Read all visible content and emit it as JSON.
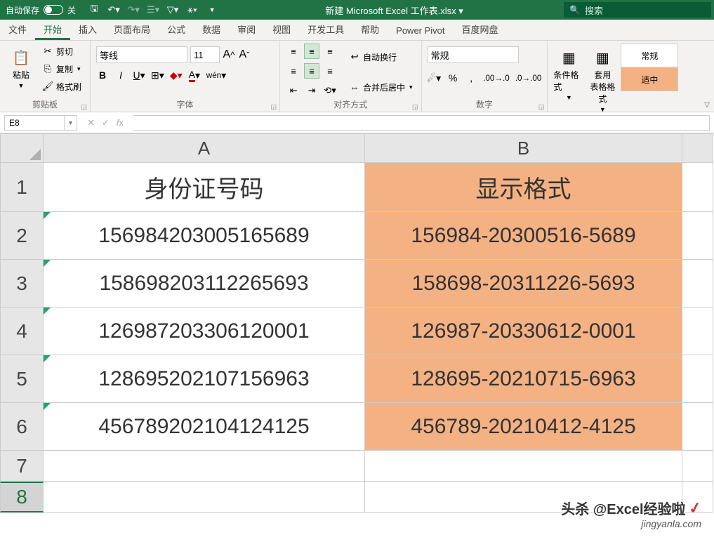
{
  "titlebar": {
    "autosave": "自动保存",
    "autosave_state": "关",
    "doc_title": "新建 Microsoft Excel 工作表.xlsx ▾",
    "search_placeholder": "搜索"
  },
  "tabs": [
    "文件",
    "开始",
    "插入",
    "页面布局",
    "公式",
    "数据",
    "审阅",
    "视图",
    "开发工具",
    "帮助",
    "Power Pivot",
    "百度网盘"
  ],
  "active_tab": 1,
  "ribbon": {
    "clipboard": {
      "label": "剪贴板",
      "paste": "粘贴",
      "cut": "剪切",
      "copy": "复制",
      "format_painter": "格式刷"
    },
    "font": {
      "label": "字体",
      "name": "等线",
      "size": "11"
    },
    "align": {
      "label": "对齐方式",
      "wrap": "自动换行",
      "merge": "合并后居中"
    },
    "number": {
      "label": "数字",
      "format": "常规"
    },
    "style": {
      "cond": "条件格式",
      "table": "套用\n表格格式",
      "gallery_normal": "常规",
      "gallery_accent": "适中"
    }
  },
  "fbar": {
    "cell_ref": "E8",
    "formula": ""
  },
  "columns": [
    "A",
    "B"
  ],
  "rows": [
    {
      "n": "1",
      "a": "身份证号码",
      "b": "显示格式",
      "header": true
    },
    {
      "n": "2",
      "a": "156984203005165689",
      "b": "156984-20300516-5689"
    },
    {
      "n": "3",
      "a": "158698203112265693",
      "b": "158698-20311226-5693"
    },
    {
      "n": "4",
      "a": "126987203306120001",
      "b": "126987-20330612-0001"
    },
    {
      "n": "5",
      "a": "128695202107156963",
      "b": "128695-20210715-6963"
    },
    {
      "n": "6",
      "a": "456789202104124125",
      "b": "456789-20210412-4125"
    },
    {
      "n": "7",
      "a": "",
      "b": ""
    },
    {
      "n": "8",
      "a": "",
      "b": "",
      "selected": true
    }
  ],
  "watermark": {
    "top": "头杀 @Excel经验啦",
    "bottom": "jingyanla.com"
  },
  "chart_data": {
    "type": "table",
    "title": "身份证号码 → 显示格式",
    "columns": [
      "身份证号码",
      "显示格式"
    ],
    "rows": [
      [
        "156984203005165689",
        "156984-20300516-5689"
      ],
      [
        "158698203112265693",
        "158698-20311226-5693"
      ],
      [
        "126987203306120001",
        "126987-20330612-0001"
      ],
      [
        "128695202107156963",
        "128695-20210715-6963"
      ],
      [
        "456789202104124125",
        "456789-20210412-4125"
      ]
    ]
  }
}
